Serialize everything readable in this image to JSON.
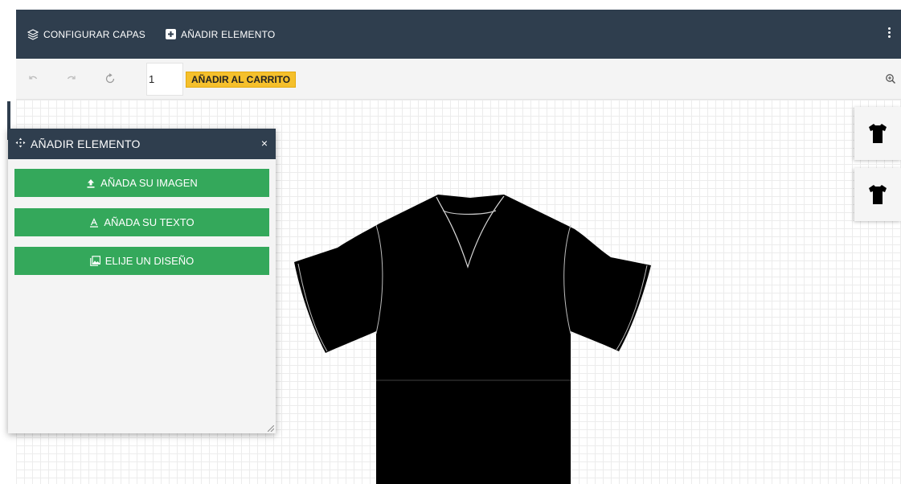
{
  "topbar": {
    "layers_label": "CONFIGURAR CAPAS",
    "add_label": "AÑADIR ELEMENTO",
    "layers_icon": "layers-icon",
    "add_icon": "plus-square-icon",
    "menu_icon": "more-vertical-icon"
  },
  "toolbar": {
    "undo_icon": "undo-icon",
    "redo_icon": "redo-icon",
    "reset_icon": "reset-icon",
    "quantity": "1",
    "cart_label": "AÑADIR AL CARRITO",
    "zoom_icon": "zoom-in-icon"
  },
  "panel": {
    "title": "AÑADIR ELEMENTO",
    "title_icon": "move-icon",
    "close": "×",
    "buttons": [
      {
        "label": "AÑADA SU IMAGEN",
        "icon": "upload-icon"
      },
      {
        "label": "AÑADA SU TEXTO",
        "icon": "text-icon"
      },
      {
        "label": "ELIJE UN DISEÑO",
        "icon": "image-icon"
      }
    ]
  },
  "product": {
    "name_icon": "tshirt-icon",
    "color": "#000000"
  },
  "views": [
    {
      "icon": "tshirt-front-icon"
    },
    {
      "icon": "tshirt-back-icon"
    }
  ],
  "colors": {
    "header": "#2f3e4e",
    "accent_green": "#34a85b",
    "cart_yellow": "#f5c02c"
  }
}
